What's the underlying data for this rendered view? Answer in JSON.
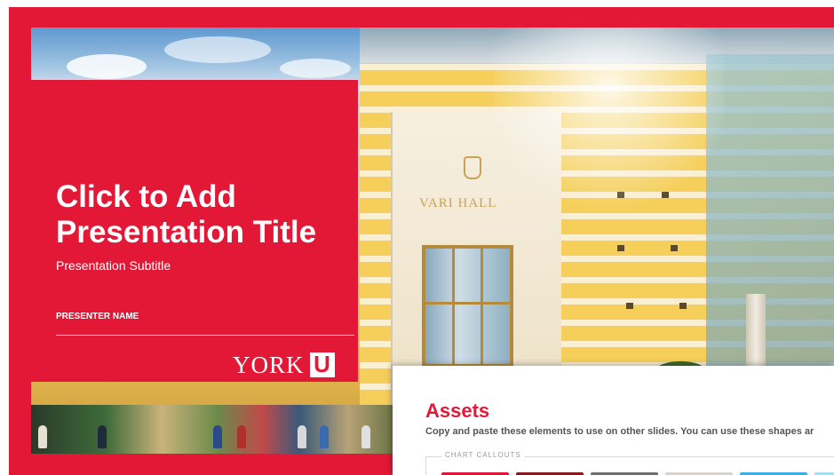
{
  "slide": {
    "title_lines": [
      "Click to Add",
      "Presentation Title"
    ],
    "subtitle": "Presentation Subtitle",
    "presenter": "PRESENTER NAME",
    "logo_text": "YORK",
    "logo_mark": "U",
    "building_sign": "VARI HALL"
  },
  "assets_panel": {
    "title": "Assets",
    "description": "Copy and paste these elements to use on other slides. You can use these shapes ar",
    "callouts_label": "CHART CALLOUTS",
    "swatches": [
      "#e31837",
      "#8b1a1a",
      "#6d6e71",
      "#d7d2cb",
      "#3ab0e2",
      "#a6dcf2"
    ]
  },
  "colors": {
    "brand_red": "#e31837",
    "text_white": "#ffffff"
  }
}
